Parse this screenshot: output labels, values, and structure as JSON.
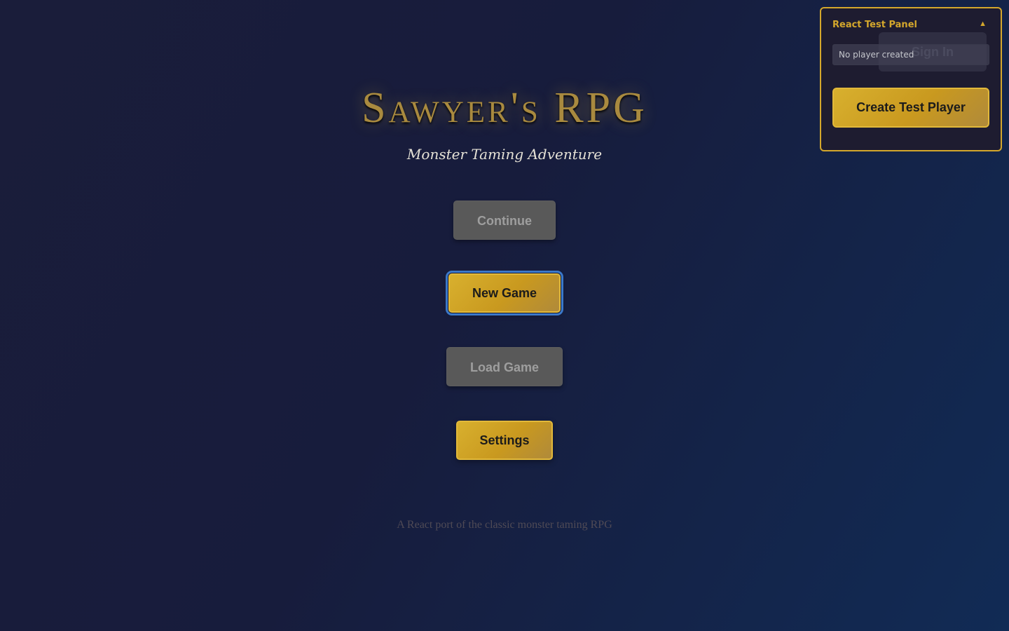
{
  "title": "Sawyer's RPG",
  "subtitle": "Monster Taming Adventure",
  "menu": {
    "continue_label": "Continue",
    "new_game_label": "New Game",
    "load_game_label": "Load Game",
    "settings_label": "Settings"
  },
  "footer_text": "A React port of the classic monster taming RPG",
  "test_panel": {
    "title": "React Test Panel",
    "toggle_icon": "▲",
    "player_status": "No player created",
    "create_button_label": "Create Test Player",
    "signin_label": "Sign In"
  },
  "colors": {
    "accent_gold": "#d4a72c",
    "disabled_button": "#595959",
    "focus_ring": "#3b78c9",
    "background_dark": "#1a1d3a",
    "background_blue": "#112b55"
  }
}
